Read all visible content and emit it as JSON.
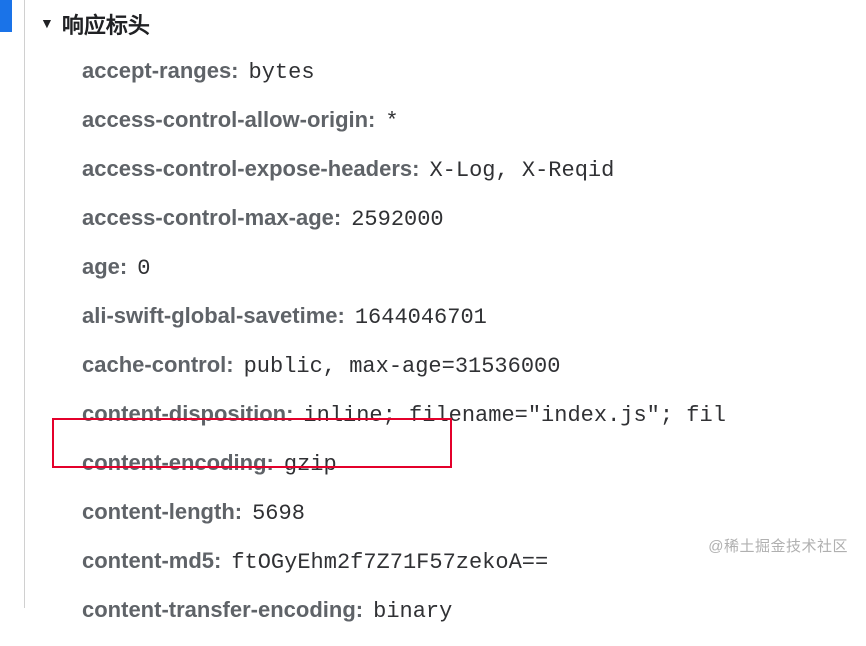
{
  "section": {
    "title": "响应标头"
  },
  "headers": [
    {
      "name": "accept-ranges:",
      "value": "bytes"
    },
    {
      "name": "access-control-allow-origin:",
      "value": "*"
    },
    {
      "name": "access-control-expose-headers:",
      "value": "X-Log, X-Reqid"
    },
    {
      "name": "access-control-max-age:",
      "value": "2592000"
    },
    {
      "name": "age:",
      "value": "0"
    },
    {
      "name": "ali-swift-global-savetime:",
      "value": "1644046701"
    },
    {
      "name": "cache-control:",
      "value": "public, max-age=31536000"
    },
    {
      "name": "content-disposition:",
      "value": "inline; filename=\"index.js\"; fil"
    },
    {
      "name": "content-encoding:",
      "value": "gzip"
    },
    {
      "name": "content-length:",
      "value": "5698"
    },
    {
      "name": "content-md5:",
      "value": "ftOGyEhm2f7Z71F57zekoA=="
    },
    {
      "name": "content-transfer-encoding:",
      "value": "binary"
    }
  ],
  "watermark": "@稀土掘金技术社区"
}
